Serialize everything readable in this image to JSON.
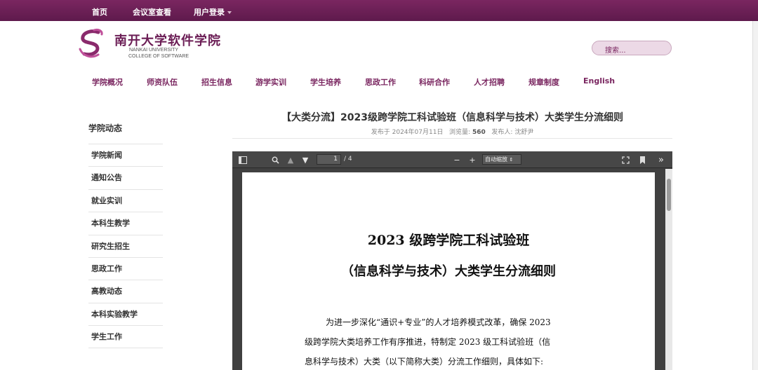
{
  "topbar": {
    "home": "首页",
    "meeting": "会议室查看",
    "login": "用户登录"
  },
  "logo": {
    "cn": "南开大学软件学院",
    "en1": "NANKAI UNIVERSITY",
    "en2": "COLLEGE OF SOFTWARE"
  },
  "search": {
    "placeholder": "搜索..."
  },
  "nav": [
    "学院概况",
    "师资队伍",
    "招生信息",
    "游学实训",
    "学生培养",
    "思政工作",
    "科研合作",
    "人才招聘",
    "规章制度",
    "English"
  ],
  "sidebar": {
    "title": "学院动态",
    "items": [
      "学院新闻",
      "通知公告",
      "就业实训",
      "本科生教学",
      "研究生招生",
      "思政工作",
      "高教动态",
      "本科实验教学",
      "学生工作"
    ]
  },
  "article": {
    "title": "【大类分流】2023级跨学院工科试验班（信息科学与技术）大类学生分流细则",
    "published_label": "发布于 2024年07月11日",
    "views_label": "浏览量:",
    "views": "560",
    "author_label": "发布人: 沈舒尹"
  },
  "pdf": {
    "page_current": "1",
    "page_total": "/ 4",
    "zoom": "自动缩放",
    "doc_title_1": "2023 级跨学院工科试验班",
    "doc_title_2": "（信息科学与技术）大类学生分流细则",
    "doc_line_1": "为进一步深化“通识+专业”的人才培养模式改革，确保 2023",
    "doc_line_2": "级跨学院大类培养工作有序推进，特制定 2023 级工科试验班（信",
    "doc_line_3": "息科学与技术）大类（以下简称大类）分流工作细则，具体如下:"
  },
  "colors": {
    "brand": "#7a2660",
    "topbar": "#6b1d55"
  }
}
